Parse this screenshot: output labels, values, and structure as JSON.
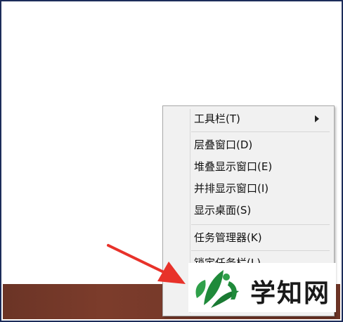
{
  "context_menu": {
    "items": [
      {
        "label": "工具栏(T)",
        "has_submenu": true
      },
      {
        "label": "层叠窗口(D)"
      },
      {
        "label": "堆叠显示窗口(E)"
      },
      {
        "label": "并排显示窗口(I)"
      },
      {
        "label": "显示桌面(S)"
      },
      {
        "label": "任务管理器(K)"
      },
      {
        "label": "锁定任务栏(L)"
      }
    ]
  },
  "annotation": {
    "arrow_color": "#e8322a"
  },
  "watermark": {
    "text": "学知网",
    "logo_color": "#1f8a3a"
  },
  "colors": {
    "frame_border": "#1c2c5a",
    "taskbar": "#74382a",
    "menu_bg": "#f1f1f1"
  }
}
